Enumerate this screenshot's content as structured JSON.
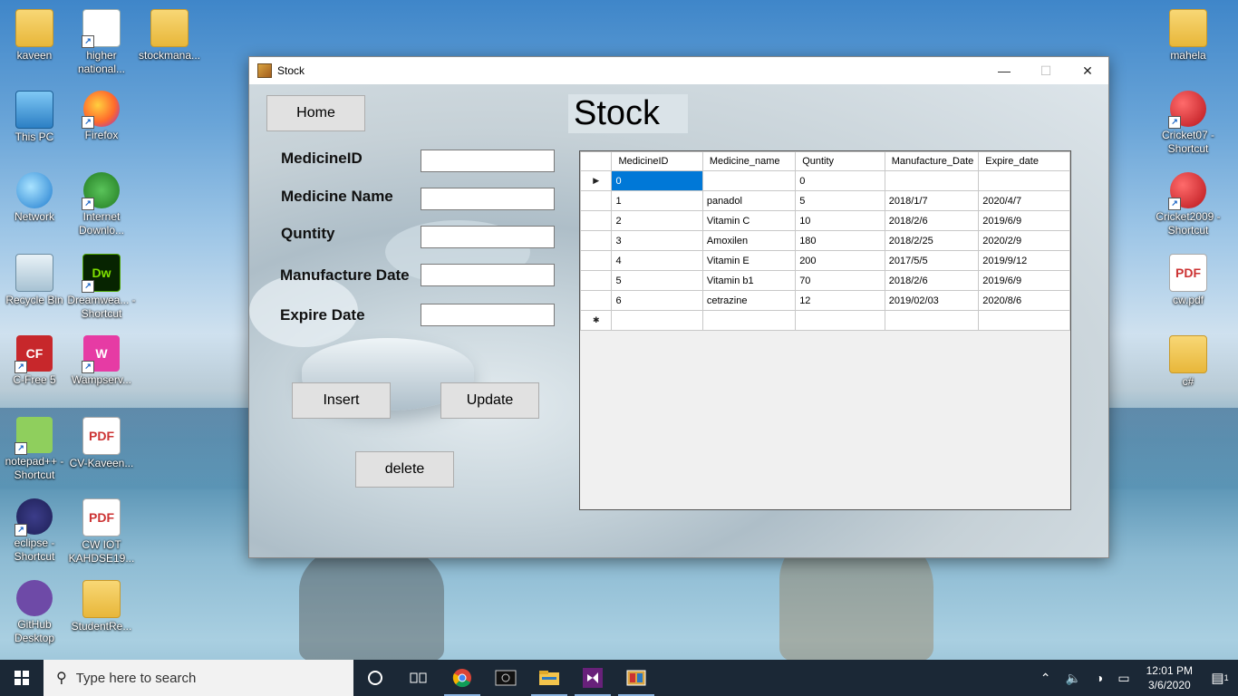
{
  "desktop": {
    "icons_left": [
      {
        "label": "kaveen",
        "icon": "user-folder-icon"
      },
      {
        "label": "This PC",
        "icon": "this-pc-icon"
      },
      {
        "label": "Network",
        "icon": "network-icon"
      },
      {
        "label": "Recycle Bin",
        "icon": "recycle-bin-icon"
      },
      {
        "label": "C-Free 5",
        "icon": "cfree-icon",
        "glyph": "CF"
      },
      {
        "label": "notepad++ - Shortcut",
        "icon": "notepadpp-icon"
      },
      {
        "label": "eclipse - Shortcut",
        "icon": "eclipse-icon"
      },
      {
        "label": "GitHub Desktop",
        "icon": "github-icon"
      }
    ],
    "icons_col2": [
      {
        "label": "higher national...",
        "icon": "document-icon"
      },
      {
        "label": "Firefox",
        "icon": "firefox-icon"
      },
      {
        "label": "Internet Downlo...",
        "icon": "idm-icon"
      },
      {
        "label": "Dreamwea... - Shortcut",
        "icon": "dreamweaver-icon",
        "glyph": "Dw"
      },
      {
        "label": "Wampserv...",
        "icon": "wampserver-icon",
        "glyph": "W"
      },
      {
        "label": "CV-Kaveen...",
        "icon": "pdf-icon",
        "glyph": "PDF"
      },
      {
        "label": "CW IOT KAHDSE19...",
        "icon": "pdf-icon",
        "glyph": "PDF"
      },
      {
        "label": "StudentRe...",
        "icon": "folder-icon"
      }
    ],
    "icon_col3": {
      "label": "stockmana...",
      "icon": "vs-folder-icon"
    },
    "icons_right": [
      {
        "label": "mahela",
        "icon": "folder-icon"
      },
      {
        "label": "Cricket07 - Shortcut",
        "icon": "cricket-icon"
      },
      {
        "label": "Cricket2009 - Shortcut",
        "icon": "cricket-icon"
      },
      {
        "label": "cw.pdf",
        "icon": "pdf-icon",
        "glyph": "PDF"
      },
      {
        "label": "c#",
        "icon": "folder-icon"
      }
    ]
  },
  "window": {
    "title": "Stock",
    "minimize": "—",
    "maximize": "☐",
    "close": "✕"
  },
  "form": {
    "home_button": "Home",
    "heading": "Stock",
    "fields": [
      {
        "label": "MedicineID",
        "value": ""
      },
      {
        "label": "Medicine Name",
        "value": ""
      },
      {
        "label": "Quntity",
        "value": ""
      },
      {
        "label": "Manufacture Date",
        "value": ""
      },
      {
        "label": "Expire Date",
        "value": ""
      }
    ],
    "insert_button": "Insert",
    "update_button": "Update",
    "delete_button": "delete"
  },
  "grid": {
    "columns": [
      "MedicineID",
      "Medicine_name",
      "Quntity",
      "Manufacture_Date",
      "Expire_date"
    ],
    "current_row_marker": "▶",
    "new_row_marker": "✱",
    "rows": [
      [
        "0",
        "",
        "0",
        "",
        ""
      ],
      [
        "1",
        "panadol",
        "5",
        "2018/1/7",
        "2020/4/7"
      ],
      [
        "2",
        "Vitamin C",
        "10",
        "2018/2/6",
        "2019/6/9"
      ],
      [
        "3",
        "Amoxilen",
        "180",
        "2018/2/25",
        "2020/2/9"
      ],
      [
        "4",
        "Vitamin E",
        "200",
        "2017/5/5",
        "2019/9/12"
      ],
      [
        "5",
        "Vitamin b1",
        "70",
        "2018/2/6",
        "2019/6/9"
      ],
      [
        "6",
        "cetrazine",
        "12",
        "2019/02/03",
        "2020/8/6"
      ]
    ]
  },
  "taskbar": {
    "search_placeholder": "Type here to search",
    "time": "12:01 PM",
    "date": "3/6/2020",
    "notifications": "1"
  }
}
